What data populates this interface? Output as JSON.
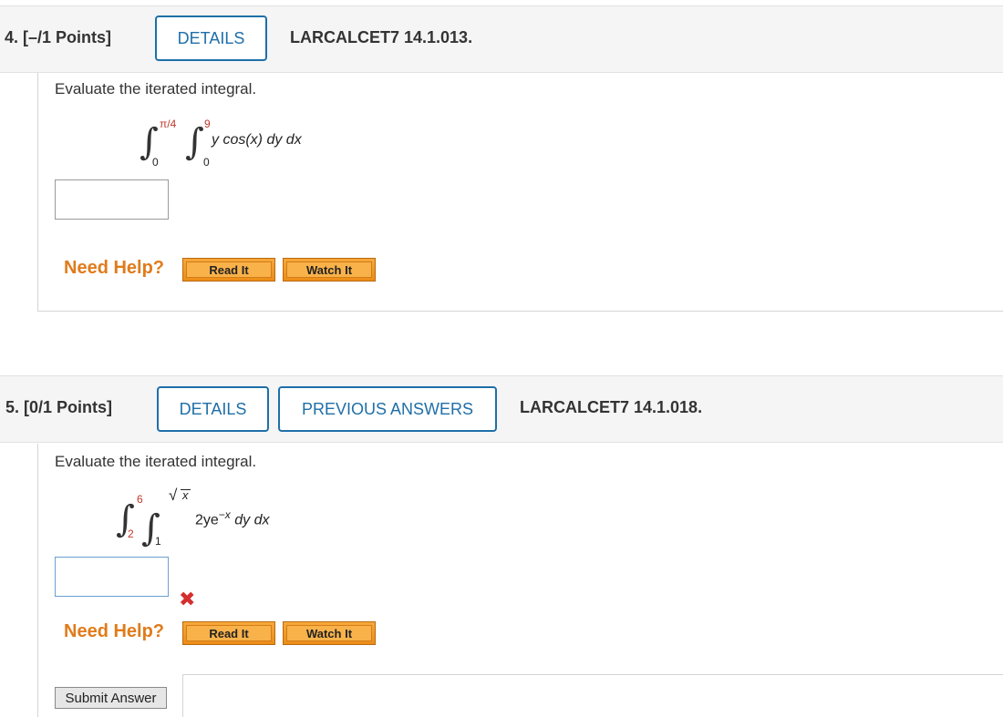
{
  "q4": {
    "number_label": "4.  [–/1 Points]",
    "details_label": "DETAILS",
    "question_id": "LARCALCET7 14.1.013.",
    "prompt": "Evaluate the iterated integral.",
    "outer_upper": "π/4",
    "outer_lower": "0",
    "inner_upper": "9",
    "inner_lower": "0",
    "integrand": "y cos(x) dy dx",
    "answer_value": "",
    "need_help": "Need Help?",
    "read_it": "Read It",
    "watch_it": "Watch It"
  },
  "q5": {
    "number_label": "5.  [0/1 Points]",
    "details_label": "DETAILS",
    "previous_answers_label": "PREVIOUS ANSWERS",
    "question_id": "LARCALCET7 14.1.018.",
    "prompt": "Evaluate the iterated integral.",
    "outer_upper": "6",
    "outer_lower": "2",
    "inner_upper_radical": "√",
    "inner_upper_radicand": "x",
    "inner_lower": "1",
    "integrand_base": "2ye",
    "integrand_exponent": "−x",
    "integrand_rest": " dy dx",
    "answer_value": "",
    "incorrect_mark": "✖",
    "need_help": "Need Help?",
    "read_it": "Read It",
    "watch_it": "Watch It",
    "submit_label": "Submit Answer"
  },
  "colors": {
    "details_border": "#1f6fa8",
    "need_help": "#e07b1b",
    "help_button": "#f5a030",
    "incorrect": "#d32f2f",
    "limit_red": "#c0392b"
  }
}
